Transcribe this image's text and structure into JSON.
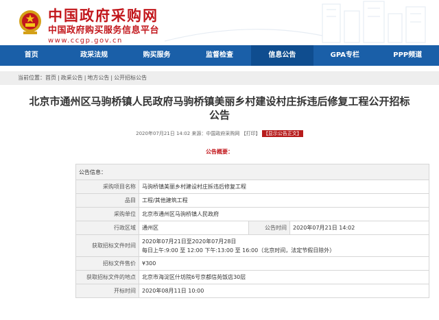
{
  "header": {
    "site_title": "中国政府采购网",
    "site_subtitle": "中国政府购买服务信息平台",
    "url": "www.ccgp.gov.cn",
    "accent_color": "#c2171c",
    "nav_color": "#1a5fa8"
  },
  "nav": {
    "items": [
      "首页",
      "政采法规",
      "购买服务",
      "监督检查",
      "信息公告",
      "GPA专栏",
      "PPP频道"
    ],
    "active_index": 4
  },
  "breadcrumb": {
    "label": "当前位置：",
    "items": [
      "首页",
      "政采公告",
      "地方公告",
      "公开招标公告"
    ],
    "separator": "|"
  },
  "article": {
    "title": "北京市通州区马驹桥镇人民政府马驹桥镇美丽乡村建设村庄拆违后修复工程公开招标公告",
    "meta_date": "2020年07月21日 14:02",
    "meta_source": "来源：中国政府采购网",
    "print_label": "【打印】",
    "show_original_label": "【显示公告正文】",
    "summary_heading": "公告概要："
  },
  "table": {
    "header": "公告信息：",
    "rows": [
      {
        "label": "采购项目名称",
        "value": "马驹桥镇美丽乡村建设村庄拆违后修复工程"
      },
      {
        "label": "品目",
        "value": "工程/其他建筑工程"
      },
      {
        "label": "采购单位",
        "value": "北京市通州区马驹桥镇人民政府"
      },
      {
        "label": "行政区域",
        "value": "通州区",
        "label2": "公告时间",
        "value2": "2020年07月21日 14:02"
      },
      {
        "label": "获取招标文件时间",
        "value": "2020年07月21日至2020年07月28日",
        "value_line2": "每日上午:9:00 至 12:00  下午:13:00 至 16:00（北京时间，法定节假日除外）"
      },
      {
        "label": "招标文件售价",
        "value": "¥300"
      },
      {
        "label": "获取招标文件的地点",
        "value": "北京市海淀区什坊院6号京都信苑饭店30层"
      },
      {
        "label": "开标时间",
        "value": "2020年08月11日 10:00"
      }
    ]
  }
}
